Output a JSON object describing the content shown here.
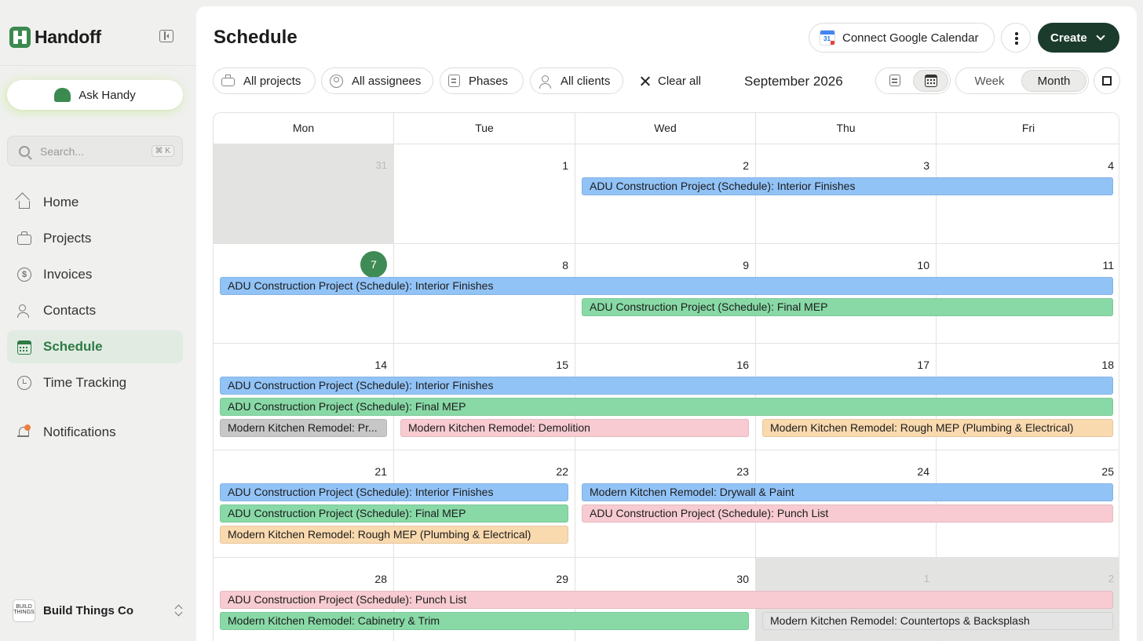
{
  "app": {
    "name": "Handoff"
  },
  "sidebar": {
    "ask_label": "Ask Handy",
    "search_placeholder": "Search...",
    "search_shortcut": "⌘ K",
    "items": [
      {
        "label": "Home",
        "icon": "home-icon"
      },
      {
        "label": "Projects",
        "icon": "briefcase-icon"
      },
      {
        "label": "Invoices",
        "icon": "dollar-coin-icon"
      },
      {
        "label": "Contacts",
        "icon": "people-icon"
      },
      {
        "label": "Schedule",
        "icon": "calendar-icon",
        "active": true
      },
      {
        "label": "Time Tracking",
        "icon": "clock-icon"
      },
      {
        "label": "Notifications",
        "icon": "bell-icon"
      }
    ],
    "workspace": {
      "name": "Build Things Co",
      "avatar_text": "BUILD THINGS"
    }
  },
  "header": {
    "title": "Schedule",
    "google_label": "Connect Google Calendar",
    "google_icon_text": "31",
    "create_label": "Create"
  },
  "filters": {
    "projects": "All projects",
    "assignees": "All assignees",
    "phases": "Phases",
    "clients": "All clients",
    "clear": "Clear all"
  },
  "calendar": {
    "month_label": "September 2026",
    "range_options": [
      "Week",
      "Month"
    ],
    "active_range": "Month",
    "day_names": [
      "Mon",
      "Tue",
      "Wed",
      "Thu",
      "Fri"
    ],
    "weeks": [
      [
        {
          "d": "31",
          "m": true
        },
        {
          "d": "1"
        },
        {
          "d": "2"
        },
        {
          "d": "3"
        },
        {
          "d": "4"
        }
      ],
      [
        {
          "d": "7",
          "today": true
        },
        {
          "d": "8"
        },
        {
          "d": "9"
        },
        {
          "d": "10"
        },
        {
          "d": "11"
        }
      ],
      [
        {
          "d": "14"
        },
        {
          "d": "15"
        },
        {
          "d": "16"
        },
        {
          "d": "17"
        },
        {
          "d": "18"
        }
      ],
      [
        {
          "d": "21"
        },
        {
          "d": "22"
        },
        {
          "d": "23"
        },
        {
          "d": "24"
        },
        {
          "d": "25"
        }
      ],
      [
        {
          "d": "28"
        },
        {
          "d": "29"
        },
        {
          "d": "30"
        },
        {
          "d": "1",
          "m": true
        },
        {
          "d": "2",
          "m": true
        }
      ]
    ],
    "events": [
      {
        "week": 0,
        "start": 2,
        "end": 4,
        "lane": 0,
        "color": "blue",
        "label": "ADU Construction Project (Schedule): Interior Finishes"
      },
      {
        "week": 1,
        "start": 0,
        "end": 4,
        "lane": 0,
        "color": "blue",
        "label": "ADU Construction Project (Schedule): Interior Finishes"
      },
      {
        "week": 1,
        "start": 2,
        "end": 4,
        "lane": 1,
        "color": "green",
        "label": "ADU Construction Project (Schedule): Final MEP"
      },
      {
        "week": 2,
        "start": 0,
        "end": 4,
        "lane": 0,
        "color": "blue",
        "label": "ADU Construction Project (Schedule): Interior Finishes"
      },
      {
        "week": 2,
        "start": 0,
        "end": 4,
        "lane": 1,
        "color": "green",
        "label": "ADU Construction Project (Schedule): Final MEP"
      },
      {
        "week": 2,
        "start": 0,
        "end": 0,
        "lane": 2,
        "color": "gray",
        "label": "Modern Kitchen Remodel: Pr..."
      },
      {
        "week": 2,
        "start": 1,
        "end": 2,
        "lane": 2,
        "color": "pink",
        "label": "Modern Kitchen Remodel: Demolition"
      },
      {
        "week": 2,
        "start": 3,
        "end": 4,
        "lane": 2,
        "color": "peach",
        "label": "Modern Kitchen Remodel: Rough MEP (Plumbing & Electrical)"
      },
      {
        "week": 3,
        "start": 0,
        "end": 1,
        "lane": 0,
        "color": "blue",
        "label": "ADU Construction Project (Schedule): Interior Finishes"
      },
      {
        "week": 3,
        "start": 0,
        "end": 1,
        "lane": 1,
        "color": "green",
        "label": "ADU Construction Project (Schedule): Final MEP"
      },
      {
        "week": 3,
        "start": 0,
        "end": 1,
        "lane": 2,
        "color": "peach",
        "label": "Modern Kitchen Remodel: Rough MEP (Plumbing & Electrical)"
      },
      {
        "week": 3,
        "start": 2,
        "end": 4,
        "lane": 0,
        "color": "blue",
        "label": "Modern Kitchen Remodel: Drywall & Paint"
      },
      {
        "week": 3,
        "start": 2,
        "end": 4,
        "lane": 1,
        "color": "pink",
        "label": "ADU Construction Project (Schedule): Punch List"
      },
      {
        "week": 4,
        "start": 0,
        "end": 4,
        "lane": 0,
        "color": "pink",
        "label": "ADU Construction Project (Schedule): Punch List"
      },
      {
        "week": 4,
        "start": 0,
        "end": 2,
        "lane": 1,
        "color": "green",
        "label": "Modern Kitchen Remodel: Cabinetry & Trim"
      },
      {
        "week": 4,
        "start": 3,
        "end": 4,
        "lane": 1,
        "color": "lgray",
        "label": "Modern Kitchen Remodel: Countertops & Backsplash"
      }
    ]
  },
  "colors": {
    "brand": "#3b8a4f",
    "create_button": "#1b3b2d",
    "active_nav_bg": "#e1ebe2"
  }
}
